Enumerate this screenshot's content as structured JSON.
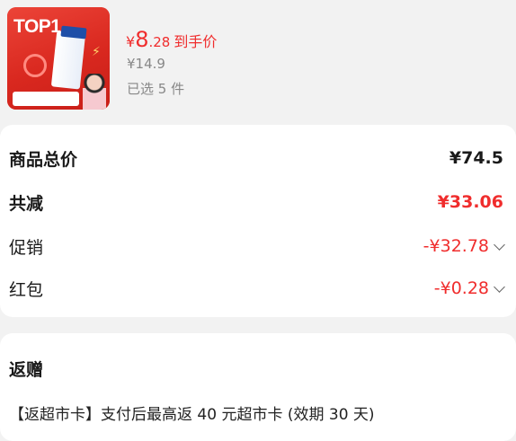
{
  "product": {
    "badge_text": "TOP1",
    "price_currency": "¥",
    "price_int": "8",
    "price_dec": ".28",
    "price_tag": "到手价",
    "original_price": "¥14.9",
    "selected_count": "已选 5 件"
  },
  "summary": {
    "total_label": "商品总价",
    "total_value": "¥74.5",
    "reduce_label": "共减",
    "reduce_value": "¥33.06",
    "promo_label": "促销",
    "promo_value": "-¥32.78",
    "redpacket_label": "红包",
    "redpacket_value": "-¥0.28"
  },
  "rebate": {
    "title": "返赠",
    "text": "【返超市卡】支付后最高返 40 元超市卡 (效期 30 天)"
  },
  "colors": {
    "accent_red": "#f02d2d",
    "background": "#f2f2f2"
  }
}
